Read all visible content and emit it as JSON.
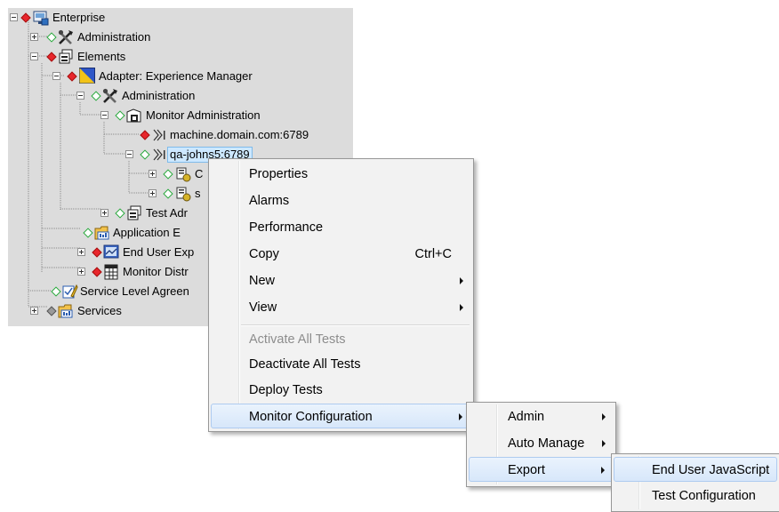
{
  "tree": {
    "items": [
      {
        "label": "Enterprise"
      },
      {
        "label": "Administration"
      },
      {
        "label": "Elements"
      },
      {
        "label": "Adapter: Experience Manager"
      },
      {
        "label": "Administration"
      },
      {
        "label": "Monitor Administration"
      },
      {
        "label": "machine.domain.com:6789"
      },
      {
        "label": "qa-johns5:6789"
      },
      {
        "label": "C"
      },
      {
        "label": "s"
      },
      {
        "label": "Test Adr"
      },
      {
        "label": "Application E"
      },
      {
        "label": "End User Exp"
      },
      {
        "label": "Monitor Distr"
      },
      {
        "label": "Service Level Agreen"
      },
      {
        "label": "Services"
      }
    ]
  },
  "context_menu": {
    "items": [
      {
        "label": "Properties"
      },
      {
        "label": "Alarms"
      },
      {
        "label": "Performance"
      },
      {
        "label": "Copy",
        "shortcut": "Ctrl+C"
      },
      {
        "label": "New"
      },
      {
        "label": "View"
      },
      {
        "label": "Activate All Tests"
      },
      {
        "label": "Deactivate All Tests"
      },
      {
        "label": "Deploy Tests"
      },
      {
        "label": "Monitor Configuration"
      }
    ]
  },
  "submenu_monitor_configuration": {
    "items": [
      {
        "label": "Admin"
      },
      {
        "label": "Auto Manage"
      },
      {
        "label": "Export"
      }
    ]
  },
  "submenu_export": {
    "items": [
      {
        "label": "End User JavaScript"
      },
      {
        "label": "Test Configuration"
      }
    ]
  }
}
